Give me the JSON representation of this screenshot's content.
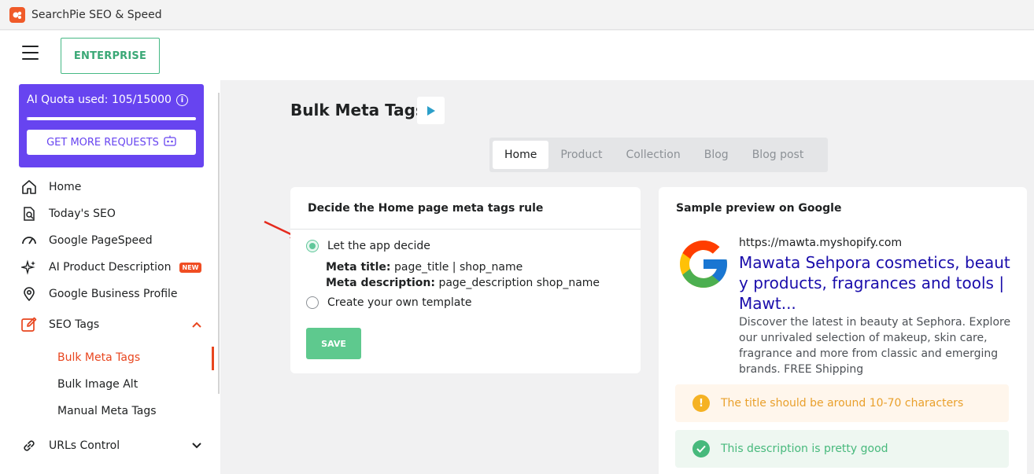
{
  "window": {
    "title": "SearchPie SEO & Speed"
  },
  "header": {
    "plan_label": "ENTERPRISE"
  },
  "quota": {
    "label": "AI Quota used: 105/15000",
    "used": 105,
    "total": 15000,
    "button_label": "GET MORE REQUESTS"
  },
  "sidebar": {
    "items": [
      {
        "label": "Home",
        "icon": "home-icon"
      },
      {
        "label": "Today's SEO",
        "icon": "search-doc-icon"
      },
      {
        "label": "Google PageSpeed",
        "icon": "gauge-icon"
      },
      {
        "label": "AI Product Description",
        "icon": "sparkle-icon",
        "badge": "NEW"
      },
      {
        "label": "Google Business Profile",
        "icon": "map-pin-icon"
      },
      {
        "label": "SEO Tags",
        "icon": "edit-icon"
      },
      {
        "label": "URLs Control",
        "icon": "link-icon"
      }
    ],
    "sub_items": [
      "Bulk Meta Tags",
      "Bulk Image Alt",
      "Manual Meta Tags"
    ]
  },
  "page": {
    "title": "Bulk Meta Tags"
  },
  "tabs": [
    "Home",
    "Product",
    "Collection",
    "Blog",
    "Blog post"
  ],
  "rule_card": {
    "title": "Decide the Home page meta tags rule",
    "option_app": "Let the app decide",
    "meta_title_label": "Meta title:",
    "meta_title_value": "page_title | shop_name",
    "meta_desc_label": "Meta description:",
    "meta_desc_value": "page_description shop_name",
    "option_custom": "Create your own template",
    "save_label": "SAVE"
  },
  "preview_card": {
    "title": "Sample preview on Google",
    "url": "https://mawta.myshopify.com",
    "result_title": "Mawata Sehpora cosmetics, beauty products, fragrances and tools | Mawt...",
    "result_desc": "Discover the latest in beauty at Sephora. Explore our unrivaled selection of makeup, skin care, fragrance and more from classic and emerging brands. FREE Shipping",
    "warn_text": "The title should be around 10-70 characters",
    "ok_text": "This description is pretty good"
  },
  "colors": {
    "accent": "#e8461f",
    "quota_bg": "#6744f0",
    "save_bg": "#5ec98e",
    "link": "#1a0dab"
  }
}
